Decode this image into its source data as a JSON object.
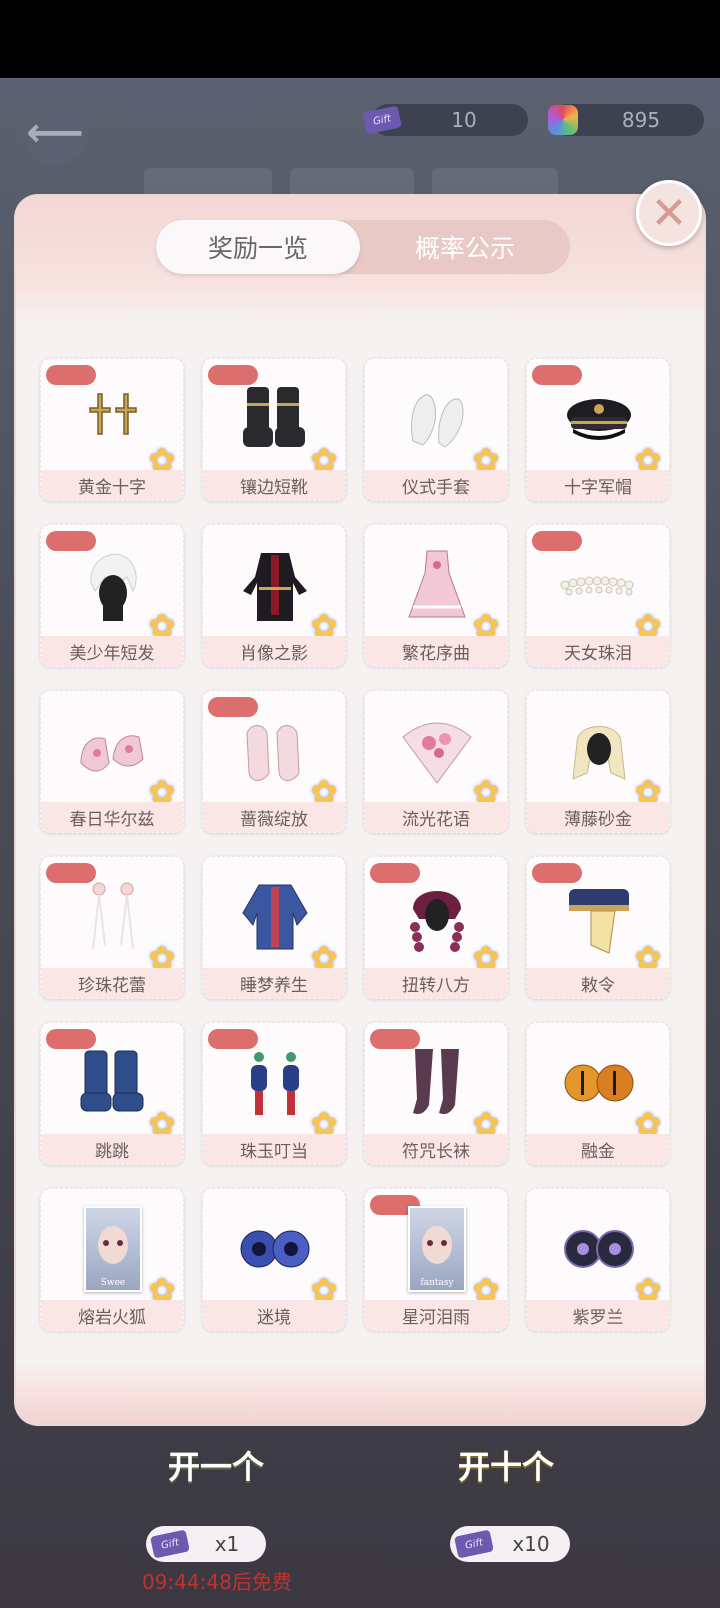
{
  "header": {
    "tickets": "10",
    "gems": "895",
    "ticket_icon_text": "Gift"
  },
  "modal": {
    "tabs": [
      {
        "label": "奖励一览",
        "active": true
      },
      {
        "label": "概率公示",
        "active": false
      }
    ],
    "close_label": "✕",
    "items": [
      {
        "name": "黄金十字",
        "badge": true,
        "icon": "gold-cross-earrings-icon"
      },
      {
        "name": "镶边短靴",
        "badge": true,
        "icon": "black-boots-icon"
      },
      {
        "name": "仪式手套",
        "badge": false,
        "icon": "white-gloves-icon"
      },
      {
        "name": "十字军帽",
        "badge": true,
        "icon": "military-cap-icon"
      },
      {
        "name": "美少年短发",
        "badge": true,
        "icon": "white-short-hair-icon"
      },
      {
        "name": "肖像之影",
        "badge": false,
        "icon": "dark-outfit-icon"
      },
      {
        "name": "繁花序曲",
        "badge": false,
        "icon": "pink-dress-icon"
      },
      {
        "name": "天女珠泪",
        "badge": true,
        "icon": "pearl-headband-icon"
      },
      {
        "name": "春日华尔兹",
        "badge": false,
        "icon": "pink-shoes-icon"
      },
      {
        "name": "蔷薇绽放",
        "badge": true,
        "icon": "lace-gloves-icon"
      },
      {
        "name": "流光花语",
        "badge": false,
        "icon": "flower-fan-icon"
      },
      {
        "name": "薄藤砂金",
        "badge": false,
        "icon": "blonde-hair-icon"
      },
      {
        "name": "珍珠花蕾",
        "badge": true,
        "icon": "pearl-earrings-icon"
      },
      {
        "name": "睡梦养生",
        "badge": false,
        "icon": "blue-jacket-icon"
      },
      {
        "name": "扭转八方",
        "badge": true,
        "icon": "braided-hair-icon"
      },
      {
        "name": "敕令",
        "badge": true,
        "icon": "talisman-hat-icon"
      },
      {
        "name": "跳跳",
        "badge": true,
        "icon": "blue-boots-icon"
      },
      {
        "name": "珠玉叮当",
        "badge": true,
        "icon": "lantern-earrings-icon"
      },
      {
        "name": "符咒长袜",
        "badge": true,
        "icon": "purple-stockings-icon"
      },
      {
        "name": "融金",
        "badge": false,
        "icon": "golden-eyes-icon"
      },
      {
        "name": "熔岩火狐",
        "badge": false,
        "icon": "portrait-card-icon",
        "card_text": "Swee"
      },
      {
        "name": "迷境",
        "badge": false,
        "icon": "blue-eyes-icon"
      },
      {
        "name": "星河泪雨",
        "badge": true,
        "icon": "portrait-card-icon",
        "card_text": "fantasy"
      },
      {
        "name": "紫罗兰",
        "badge": false,
        "icon": "violet-eyes-icon"
      }
    ]
  },
  "footer": {
    "open_one_label": "开一个",
    "open_ten_label": "开十个",
    "open_one_count": "x1",
    "open_ten_count": "x10",
    "timer_text": "09:44:48后免费"
  }
}
